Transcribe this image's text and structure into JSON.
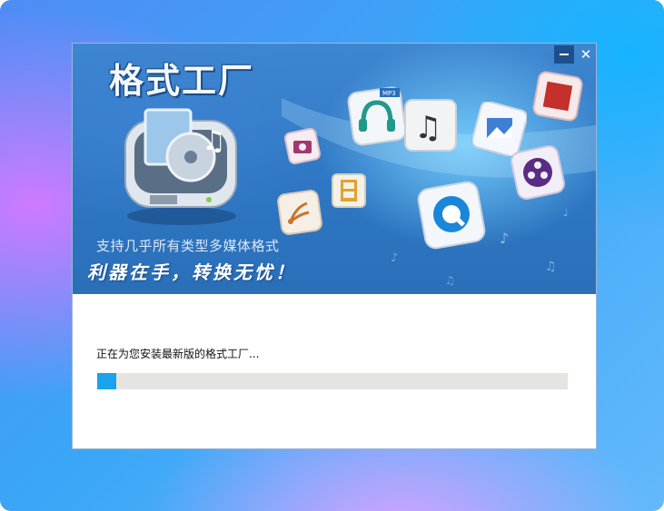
{
  "installer": {
    "logo_text": "格式工厂",
    "tagline": "支持几乎所有类型多媒体格式",
    "slogan": "利器在手，转换无忧！",
    "status_text": "正在为您安装最新版的格式工厂...",
    "progress_percent": 4,
    "close_glyph": "✕",
    "icons": [
      "format-factory-app-icon",
      "headphones-icon",
      "music-note-icon",
      "image-file-icon",
      "video-reel-icon",
      "quicktime-icon",
      "film-strip-icon",
      "audio-wave-icon",
      "camera-icon",
      "pdf-icon"
    ]
  },
  "colors": {
    "progress_fill": "#1aa3ea",
    "progress_track": "#e6e4e1",
    "banner_blue": "#2f77c4"
  }
}
